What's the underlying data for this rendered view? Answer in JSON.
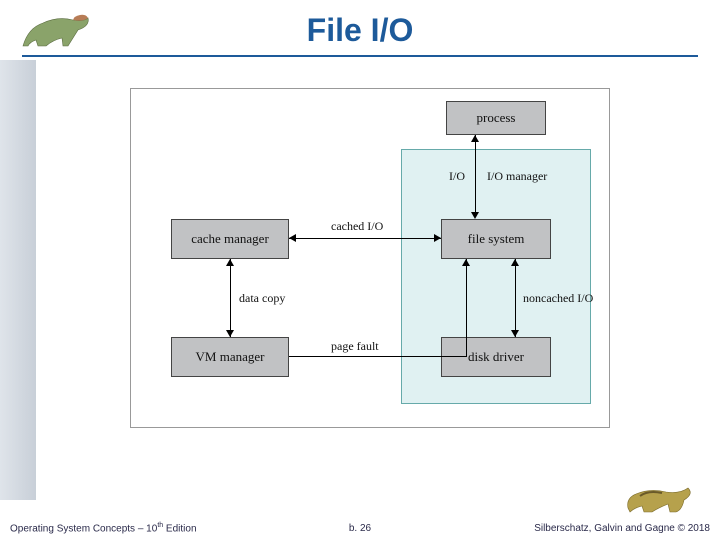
{
  "title": "File I/O",
  "diagram": {
    "boxes": {
      "process": "process",
      "cache_manager": "cache manager",
      "file_system": "file system",
      "vm_manager": "VM manager",
      "disk_driver": "disk driver"
    },
    "labels": {
      "io": "I/O",
      "io_manager": "I/O manager",
      "cached_io": "cached I/O",
      "data_copy": "data copy",
      "page_fault": "page fault",
      "noncached_io": "noncached I/O"
    }
  },
  "footer": {
    "left_prefix": "Operating System Concepts – 10",
    "left_sup": "th",
    "left_suffix": " Edition",
    "center": "b. 26",
    "right": "Silberschatz, Galvin and Gagne © 2018"
  }
}
